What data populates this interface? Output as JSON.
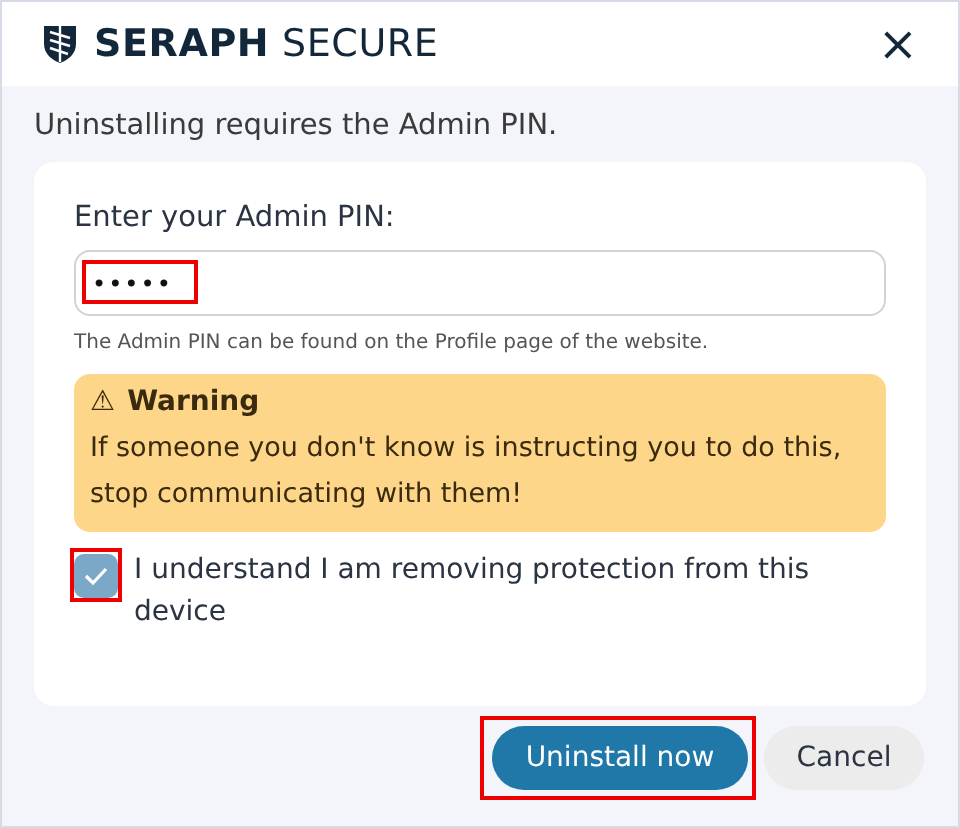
{
  "window": {
    "brand": "**SERAPH** SECURE",
    "close": "×"
  },
  "intro": "Uninstalling requires the Admin PIN.",
  "pin": {
    "label": "Enter your Admin PIN:",
    "value": "•••••",
    "highlighted": true,
    "hint": "The Admin PIN can be found on the Profile page of the website."
  },
  "warning": {
    "icon": "⚠",
    "title": "Warning",
    "text": "If someone you don't know is instructing you to do this, stop communicating with them!"
  },
  "confirm": {
    "label": "I understand I am removing protection from this device",
    "checked": true,
    "highlighted": true
  },
  "buttons": [
    {
      "label": "Uninstall now",
      "kind": "primary",
      "highlighted": true
    },
    {
      "label": "Cancel",
      "kind": "secondary",
      "highlighted": false
    }
  ]
}
